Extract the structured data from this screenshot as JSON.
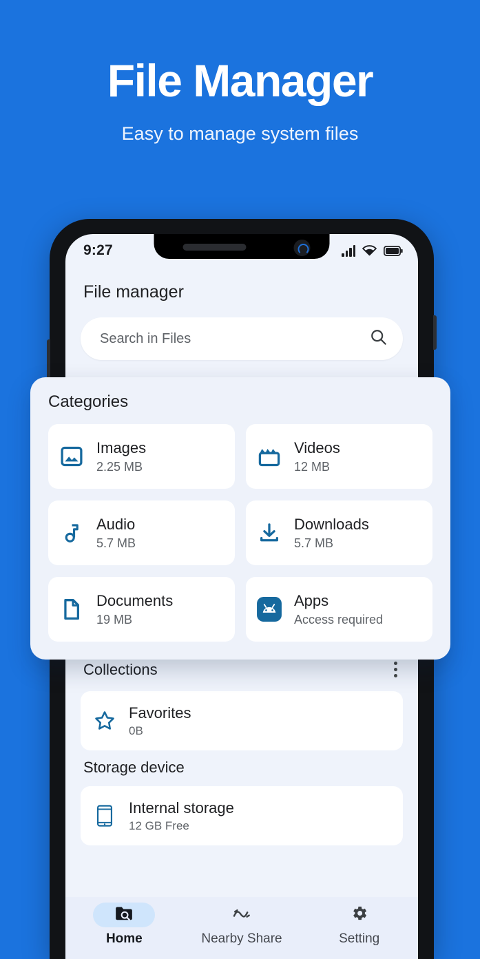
{
  "hero": {
    "title": "File Manager",
    "subtitle": "Easy to manage system files",
    "background_color": "#1b73de"
  },
  "phone": {
    "status_bar": {
      "time": "9:27",
      "signal_icon": "signal-bars-icon",
      "wifi_icon": "wifi-icon",
      "battery_icon": "battery-full-icon"
    },
    "app": {
      "title": "File manager",
      "search": {
        "placeholder": "Search in Files",
        "icon": "search-icon"
      },
      "categories": {
        "heading": "Categories",
        "items": [
          {
            "label": "Images",
            "size": "2.25 MB",
            "icon": "image-icon"
          },
          {
            "label": "Videos",
            "size": "12 MB",
            "icon": "movie-clapper-icon"
          },
          {
            "label": "Audio",
            "size": "5.7 MB",
            "icon": "music-note-icon"
          },
          {
            "label": "Downloads",
            "size": "5.7 MB",
            "icon": "download-icon"
          },
          {
            "label": "Documents",
            "size": "19 MB",
            "icon": "document-icon"
          },
          {
            "label": "Apps",
            "size": "Access required",
            "icon": "android-robot-icon"
          }
        ]
      },
      "collections": {
        "heading": "Collections",
        "menu_icon": "more-vertical-icon",
        "items": [
          {
            "label": "Favorites",
            "size": "0B",
            "icon": "star-outline-icon"
          }
        ]
      },
      "storage": {
        "heading": "Storage device",
        "items": [
          {
            "label": "Internal storage",
            "size": "12 GB Free",
            "icon": "phone-device-icon"
          }
        ]
      },
      "bottom_nav": [
        {
          "label": "Home",
          "icon": "folder-search-icon",
          "active": true
        },
        {
          "label": "Nearby Share",
          "icon": "nearby-share-icon",
          "active": false
        },
        {
          "label": "Setting",
          "icon": "gear-icon",
          "active": false
        }
      ]
    }
  },
  "colors": {
    "brand_blue": "#1b73de",
    "icon_blue": "#16699e",
    "screen_bg": "#eff3fb",
    "card_white": "#ffffff",
    "active_pill": "#cfe5fc"
  }
}
